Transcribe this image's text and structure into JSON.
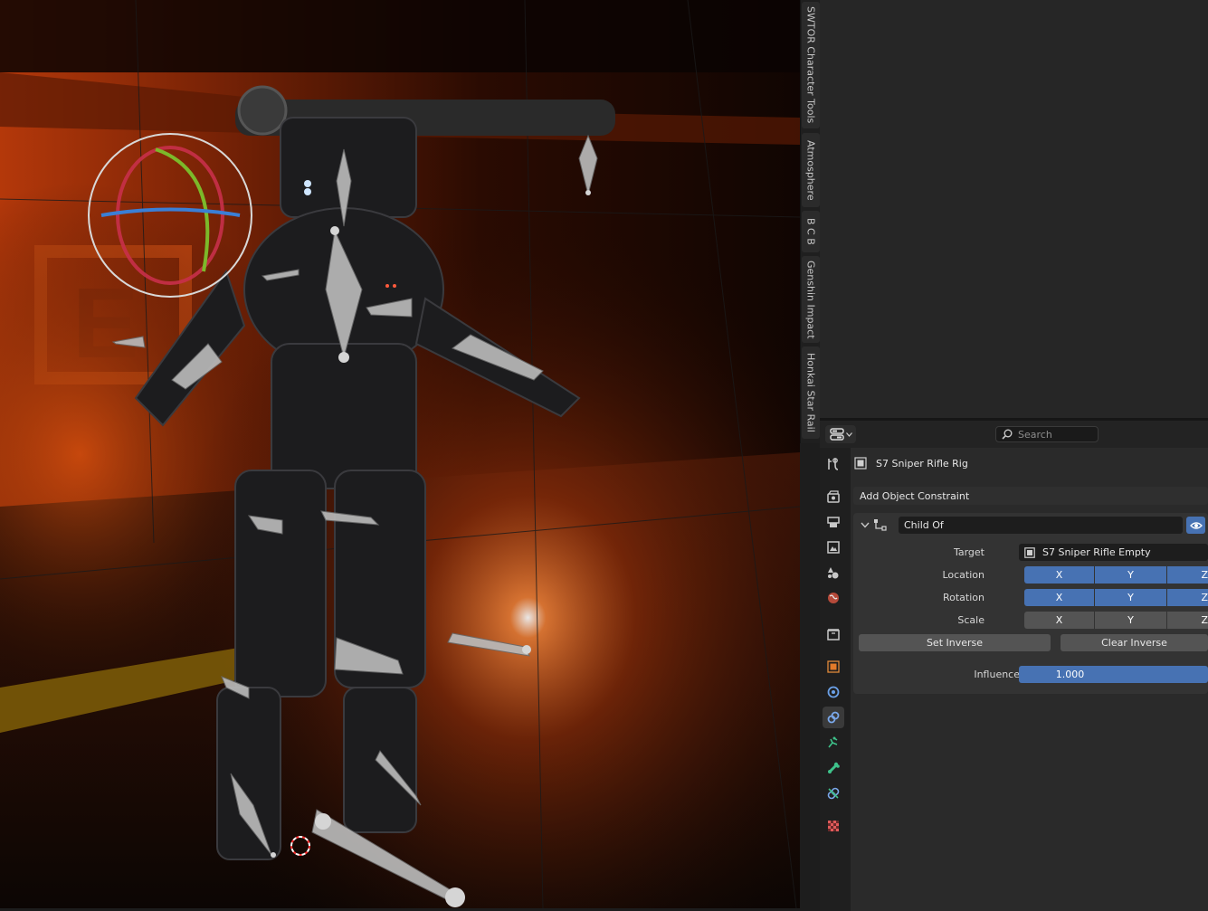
{
  "npanel": {
    "tabs": [
      "SWTOR Character Tools",
      "Atmosphere",
      "B C B",
      "Genshin Impact",
      "Honkai Star Rail"
    ]
  },
  "properties": {
    "search": {
      "placeholder": "Search",
      "value": ""
    },
    "object_name": "S7 Sniper Rifle Rig",
    "add_constraint_label": "Add Object Constraint",
    "tabs": [
      "tool-icon",
      "render-icon",
      "output-icon",
      "view-layer-icon",
      "scene-icon",
      "world-icon",
      "collection-icon",
      "object-icon",
      "modifiers-icon",
      "constraints-icon",
      "physics-icon",
      "object-data-icon",
      "bone-constraints-icon",
      "texture-icon"
    ],
    "active_tab": "constraints-icon",
    "constraint": {
      "name": "Child Of",
      "target_label": "Target",
      "target_value": "S7 Sniper Rifle Empty",
      "location_label": "Location",
      "rotation_label": "Rotation",
      "scale_label": "Scale",
      "axes": [
        "X",
        "Y",
        "Z"
      ],
      "location_axes": [
        true,
        true,
        true
      ],
      "rotation_axes": [
        true,
        true,
        true
      ],
      "scale_axes": [
        false,
        false,
        false
      ],
      "set_inverse_label": "Set Inverse",
      "clear_inverse_label": "Clear Inverse",
      "influence_label": "Influence",
      "influence_value": "1.000"
    }
  },
  "colors": {
    "accent": "#4772b3",
    "active_tab": "#3a3a3a",
    "viewport_glow": "#c0400c"
  }
}
